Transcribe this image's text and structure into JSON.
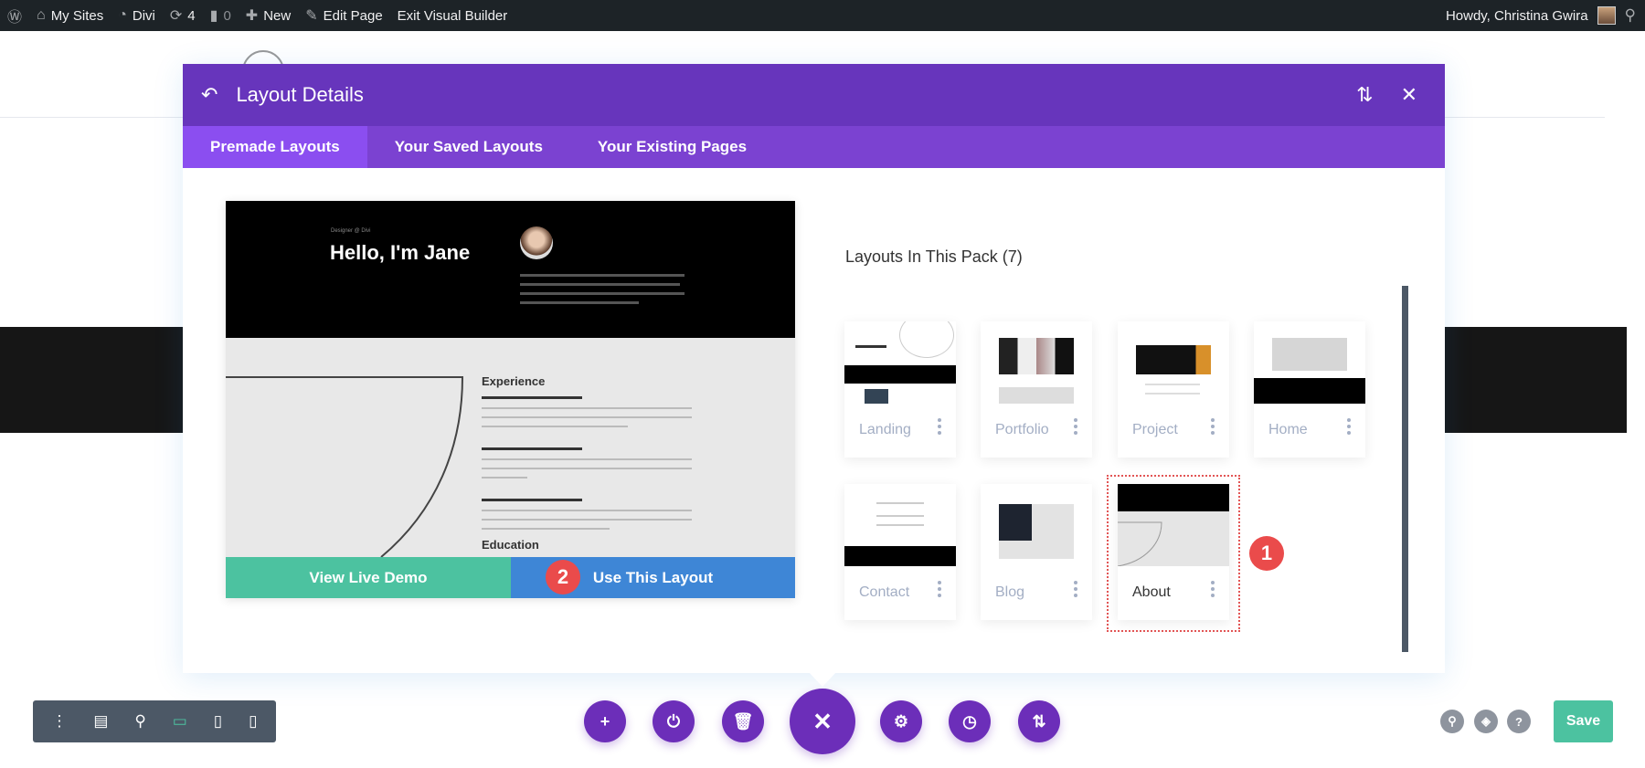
{
  "adminbar": {
    "my_sites": "My Sites",
    "divi": "Divi",
    "updates": "4",
    "comments": "0",
    "new": "New",
    "edit_page": "Edit Page",
    "exit_vb": "Exit Visual Builder",
    "howdy": "Howdy, Christina Gwira"
  },
  "modal": {
    "title": "Layout Details",
    "tabs": [
      "Premade Layouts",
      "Your Saved Layouts",
      "Your Existing Pages"
    ]
  },
  "preview": {
    "designer": "Designer @ Divi",
    "hello": "Hello, I'm Jane",
    "experience": "Experience",
    "education": "Education",
    "view_demo": "View Live Demo",
    "use_layout": "Use This Layout"
  },
  "pack": {
    "title": "Layouts In This Pack (7)",
    "layouts": [
      "Landing",
      "Portfolio",
      "Project",
      "Home",
      "Contact",
      "Blog",
      "About"
    ],
    "selected": "About"
  },
  "badges": {
    "one": "1",
    "two": "2"
  },
  "bottom": {
    "save": "Save"
  },
  "colors": {
    "purple": "#6735bc",
    "tab": "#7b42d1",
    "green": "#4cc2a0",
    "blue": "#3e86d6",
    "badge": "#ea4b4b"
  }
}
